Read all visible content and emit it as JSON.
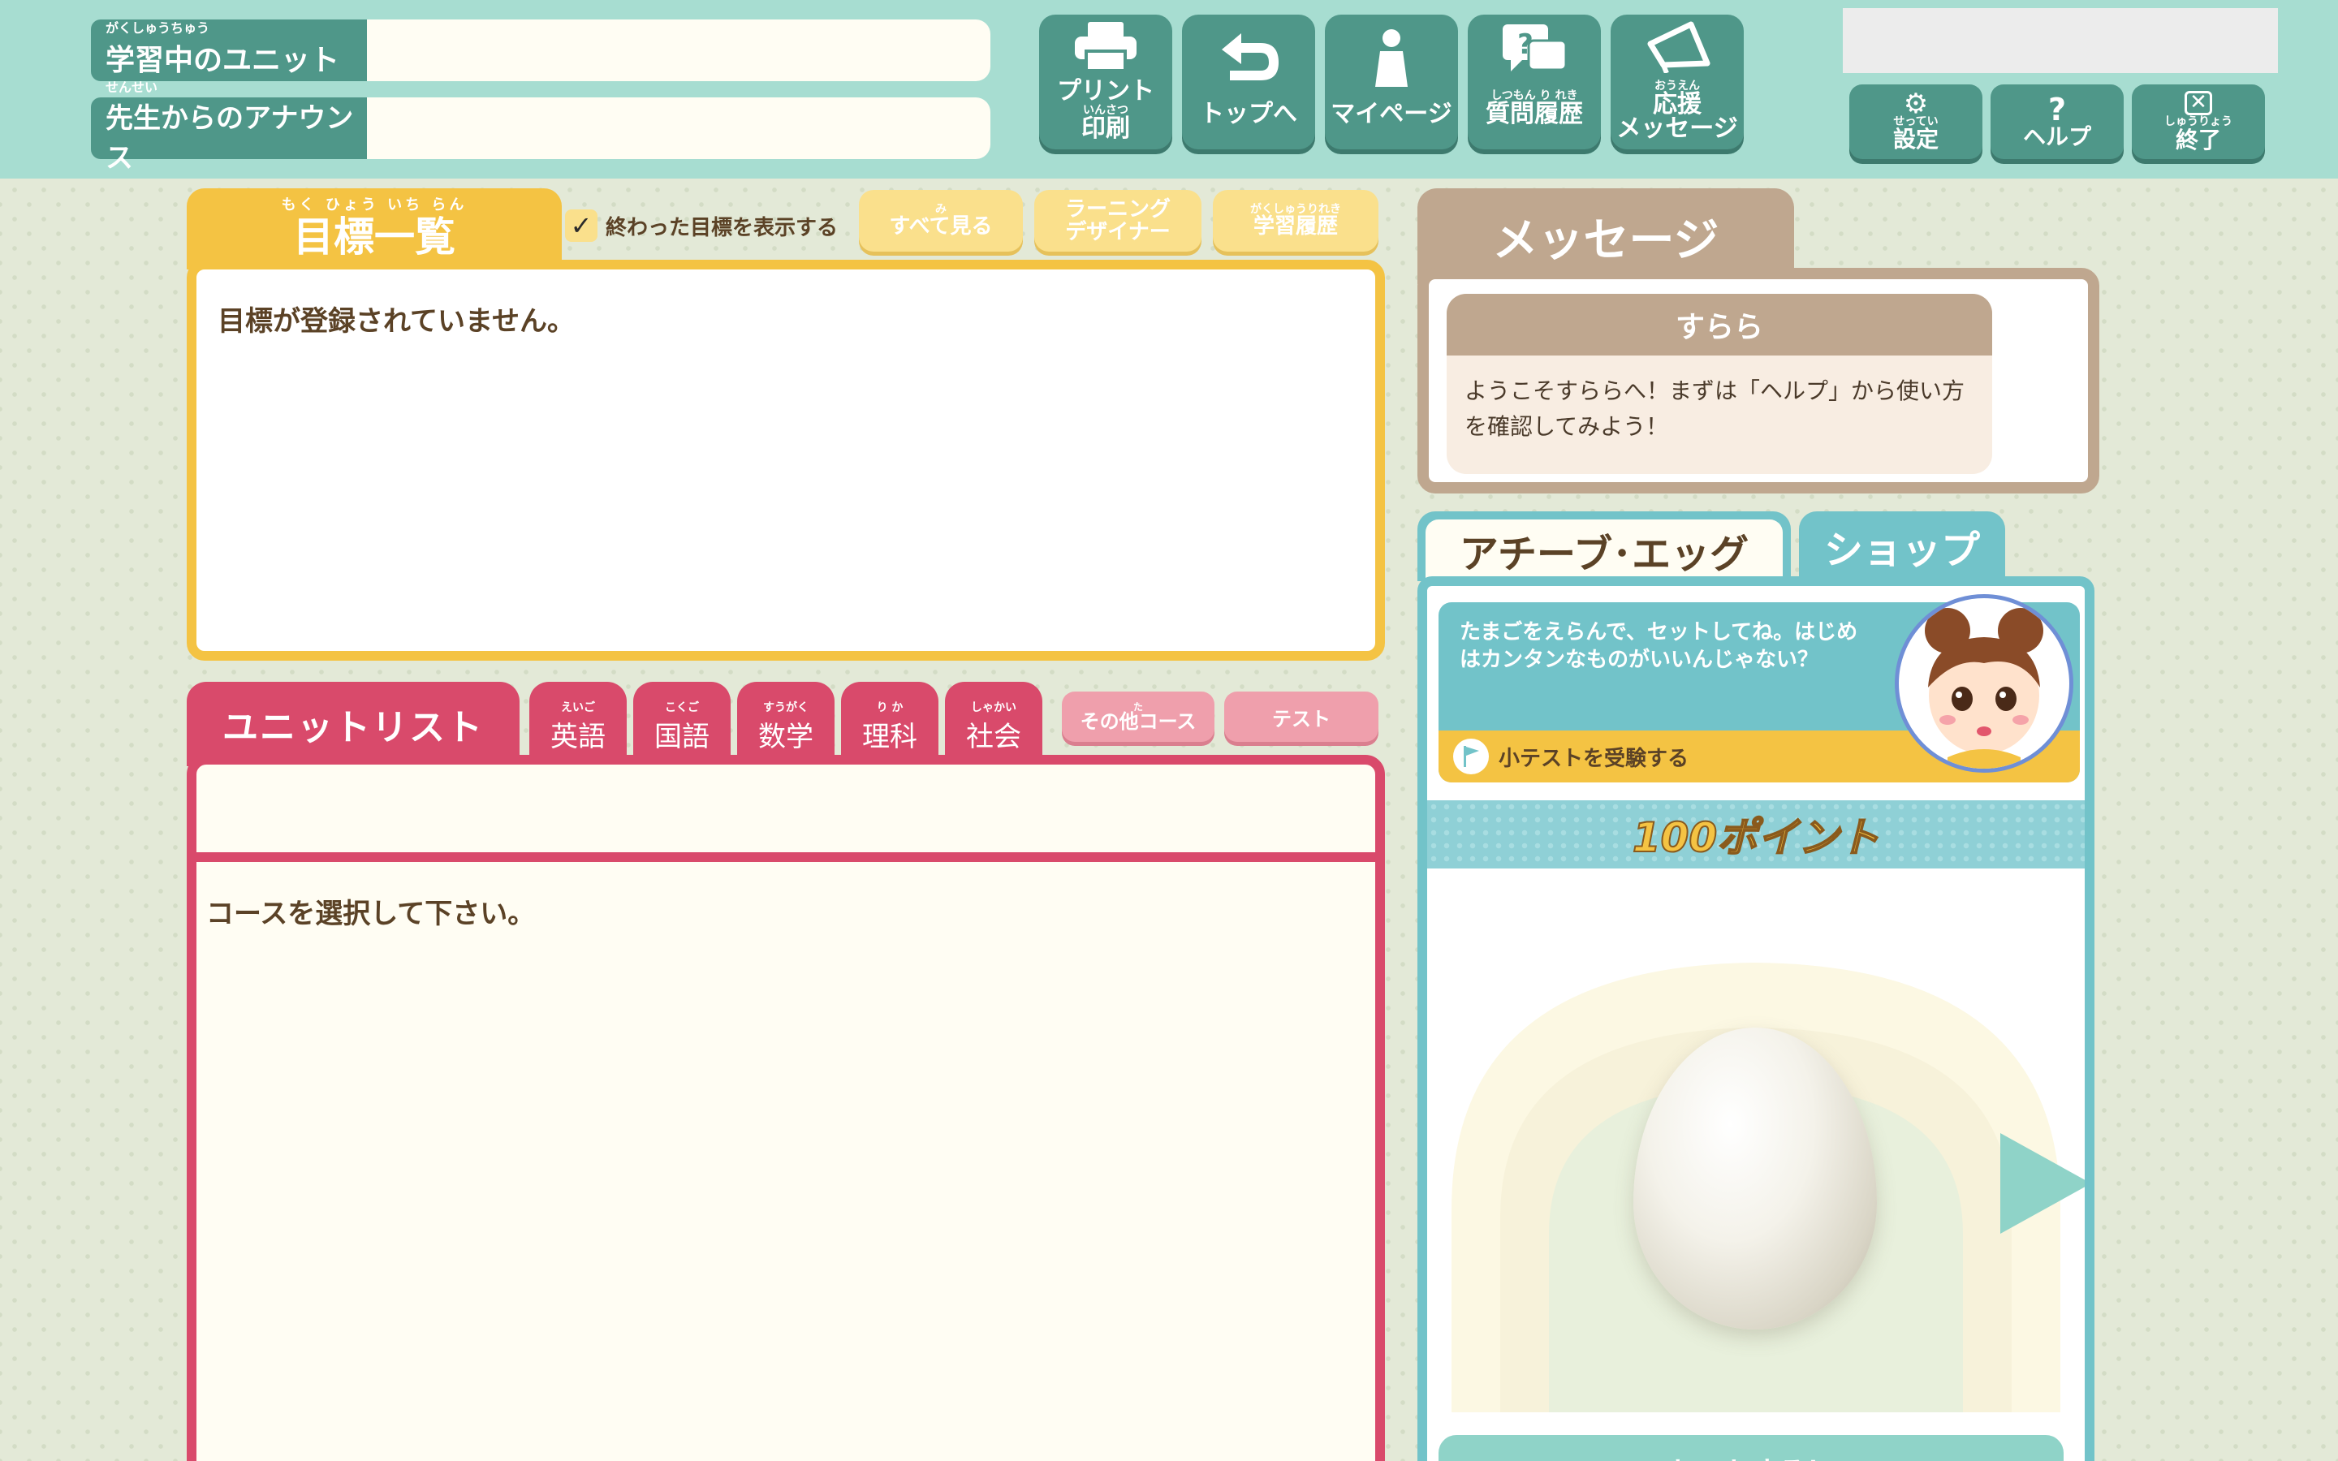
{
  "header": {
    "current_unit": {
      "ruby": "がくしゅうちゅう",
      "label": "学習中のユニット"
    },
    "announce": {
      "ruby": "せんせい",
      "label": "先生からのアナウンス"
    },
    "buttons": [
      {
        "label": "プリント",
        "ruby": "いんさつ",
        "sub": "印刷",
        "icon": "printer-icon"
      },
      {
        "label": "トップへ",
        "icon": "return-arrow-icon"
      },
      {
        "label": "マイページ",
        "icon": "person-icon"
      },
      {
        "ruby": "しつもん り れき",
        "label": "質問履歴",
        "icon": "question-bubble-icon"
      },
      {
        "ruby": "おうえん",
        "label": "応援",
        "sub": "メッセージ",
        "icon": "megaphone-icon"
      }
    ],
    "small_buttons": [
      {
        "ruby": "せってい",
        "label": "設定",
        "icon": "gear-icon"
      },
      {
        "label": "ヘルプ",
        "icon": "question-mark-icon"
      },
      {
        "ruby": "しゅうりょう",
        "label": "終了",
        "icon": "close-icon"
      }
    ]
  },
  "goals": {
    "ruby": "もく ひょう いち らん",
    "title": "目標一覧",
    "show_finished": "終わった目標を表示する",
    "see_all_ruby": "み",
    "see_all": "すべて見る",
    "designer_line1": "ラーニング",
    "designer_line2": "デザイナー",
    "history_ruby": "がくしゅうりれき",
    "history": "学習履歴",
    "empty": "目標が登録されていません。"
  },
  "units": {
    "title": "ユニットリスト",
    "subjects": [
      {
        "ruby": "えいご",
        "label": "英語"
      },
      {
        "ruby": "こくご",
        "label": "国語"
      },
      {
        "ruby": "すうがく",
        "label": "数学"
      },
      {
        "ruby": "り か",
        "label": "理科"
      },
      {
        "ruby": "しゃかい",
        "label": "社会"
      }
    ],
    "other_ruby": "た",
    "other": "その他コース",
    "test": "テスト",
    "empty": "コースを選択して下さい。"
  },
  "message": {
    "title": "メッセージ",
    "sender": "すらら",
    "body": "ようこそすららへ！まずは「ヘルプ」から使い方を確認してみよう！"
  },
  "egg": {
    "tab_active": "アチーブ･エッグ",
    "tab_shop": "ショップ",
    "hint": "たまごをえらんで、セットしてね。はじめはカンタンなものがいいんじゃない？",
    "quiz": "小テストを受験する",
    "points": "100ポイント",
    "set_button": "セットする！"
  },
  "colors": {
    "header_bg": "#a7ddd1",
    "teal_button": "#4f9789",
    "goal_yellow": "#f4c343",
    "unit_pink": "#d94a6b",
    "message_tan": "#bfa78f",
    "egg_teal": "#72c3c9"
  }
}
